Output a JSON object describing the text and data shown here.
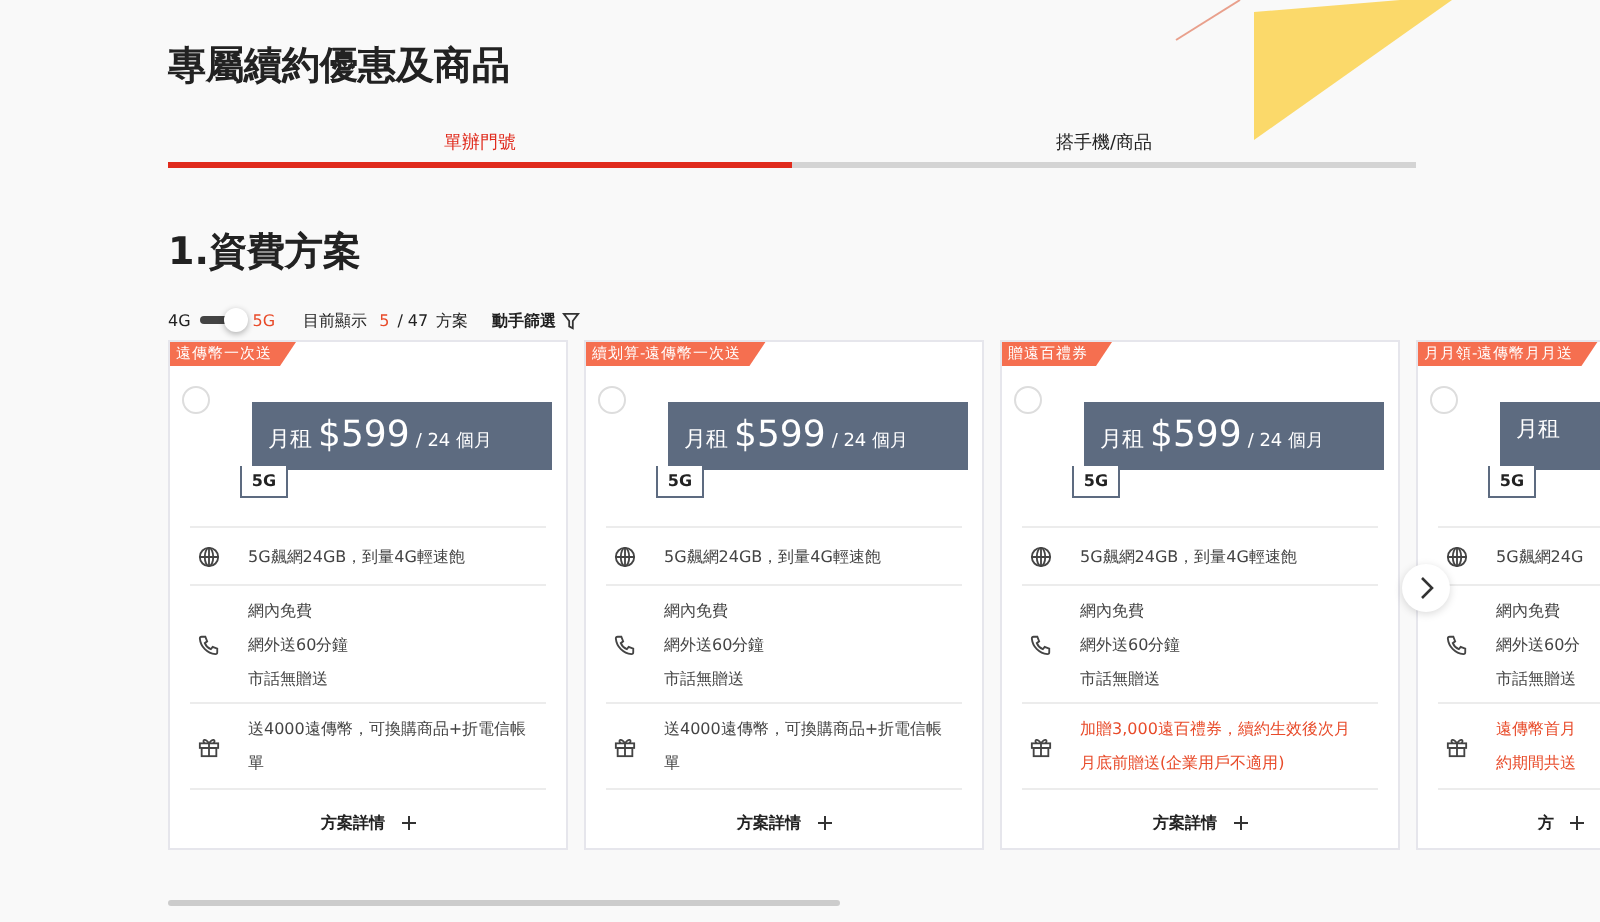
{
  "page_title": "專屬續約優惠及商品",
  "tabs": [
    {
      "label": "單辦門號",
      "selected": true
    },
    {
      "label": "搭手機/商品",
      "selected": false
    }
  ],
  "section_title": "1.資費方案",
  "filter": {
    "label_4g": "4G",
    "label_5g": "5G",
    "is_5g": true,
    "showing_label": "目前顯示",
    "shown": "5",
    "total": "/ 47",
    "unit": "方案",
    "filter_button": "動手篩選"
  },
  "plans": [
    {
      "badge": "遠傳幣一次送",
      "selected": false,
      "price_label": "月租",
      "price": "$599",
      "term": "/ 24 個月",
      "network": "5G",
      "data": "5G飆網24GB，到量4G輕速飽",
      "voice": [
        "網內免費",
        "網外送60分鐘",
        "市話無贈送"
      ],
      "gift": [
        "送4000遠傳幣，可換購商品+折電信帳",
        "單"
      ],
      "gift_highlight": false,
      "details": "方案詳情"
    },
    {
      "badge": "續划算-遠傳幣一次送",
      "selected": false,
      "price_label": "月租",
      "price": "$599",
      "term": "/ 24 個月",
      "network": "5G",
      "data": "5G飆網24GB，到量4G輕速飽",
      "voice": [
        "網內免費",
        "網外送60分鐘",
        "市話無贈送"
      ],
      "gift": [
        "送4000遠傳幣，可換購商品+折電信帳",
        "單"
      ],
      "gift_highlight": false,
      "details": "方案詳情"
    },
    {
      "badge": "贈遠百禮券",
      "selected": false,
      "price_label": "月租",
      "price": "$599",
      "term": "/ 24 個月",
      "network": "5G",
      "data": "5G飆網24GB，到量4G輕速飽",
      "voice": [
        "網內免費",
        "網外送60分鐘",
        "市話無贈送"
      ],
      "gift": [
        "加贈3,000遠百禮券，續約生效後次月",
        "月底前贈送(企業用戶不適用)"
      ],
      "gift_highlight": true,
      "details": "方案詳情"
    },
    {
      "badge": "月月領-遠傳幣月月送",
      "selected": false,
      "price_label": "月租",
      "network": "5G",
      "data": "5G飆網24G",
      "voice": [
        "網內免費",
        "網外送60分",
        "市話無贈送"
      ],
      "gift": [
        "遠傳幣首月",
        "約期間共送"
      ],
      "gift_highlight": true,
      "details": "方"
    }
  ]
}
